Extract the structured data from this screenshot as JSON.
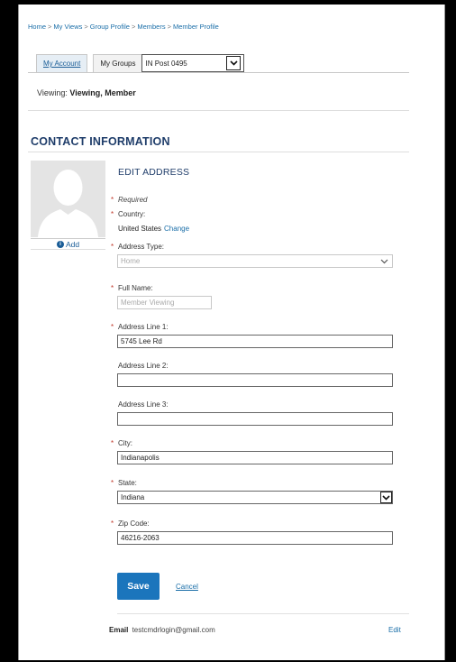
{
  "breadcrumb": [
    "Home",
    "My Views",
    "Group Profile",
    "Members",
    "Member Profile"
  ],
  "breadcrumb_separator": ">",
  "tabs": {
    "my_account": "My Account",
    "my_groups": "My Groups",
    "group_select_value": "IN Post 0495"
  },
  "viewing": {
    "label": "Viewing:",
    "value": "Viewing, Member"
  },
  "section_title": "CONTACT INFORMATION",
  "avatar": {
    "add_label": "Add",
    "info_glyph": "i"
  },
  "form": {
    "title": "EDIT ADDRESS",
    "required_note": "Required",
    "required_marker": "*",
    "country": {
      "label": "Country:",
      "value": "United States",
      "change_label": "Change"
    },
    "address_type": {
      "label": "Address Type:",
      "value": "Home",
      "disabled": true
    },
    "full_name": {
      "label": "Full Name:",
      "value": "Member Viewing",
      "disabled": true
    },
    "address_line_1": {
      "label": "Address Line 1:",
      "value": "5745 Lee Rd"
    },
    "address_line_2": {
      "label": "Address Line 2:",
      "value": ""
    },
    "address_line_3": {
      "label": "Address Line 3:",
      "value": ""
    },
    "city": {
      "label": "City:",
      "value": "Indianapolis"
    },
    "state": {
      "label": "State:",
      "value": "Indiana"
    },
    "zip": {
      "label": "Zip Code:",
      "value": "46216-2063"
    },
    "save_label": "Save",
    "cancel_label": "Cancel"
  },
  "email": {
    "label": "Email",
    "value": "testcmdrlogin@gmail.com",
    "edit_label": "Edit"
  },
  "colors": {
    "accent": "#1b75bc",
    "heading": "#1f3d6a",
    "link": "#1a6ea8",
    "required": "#c0392b"
  }
}
